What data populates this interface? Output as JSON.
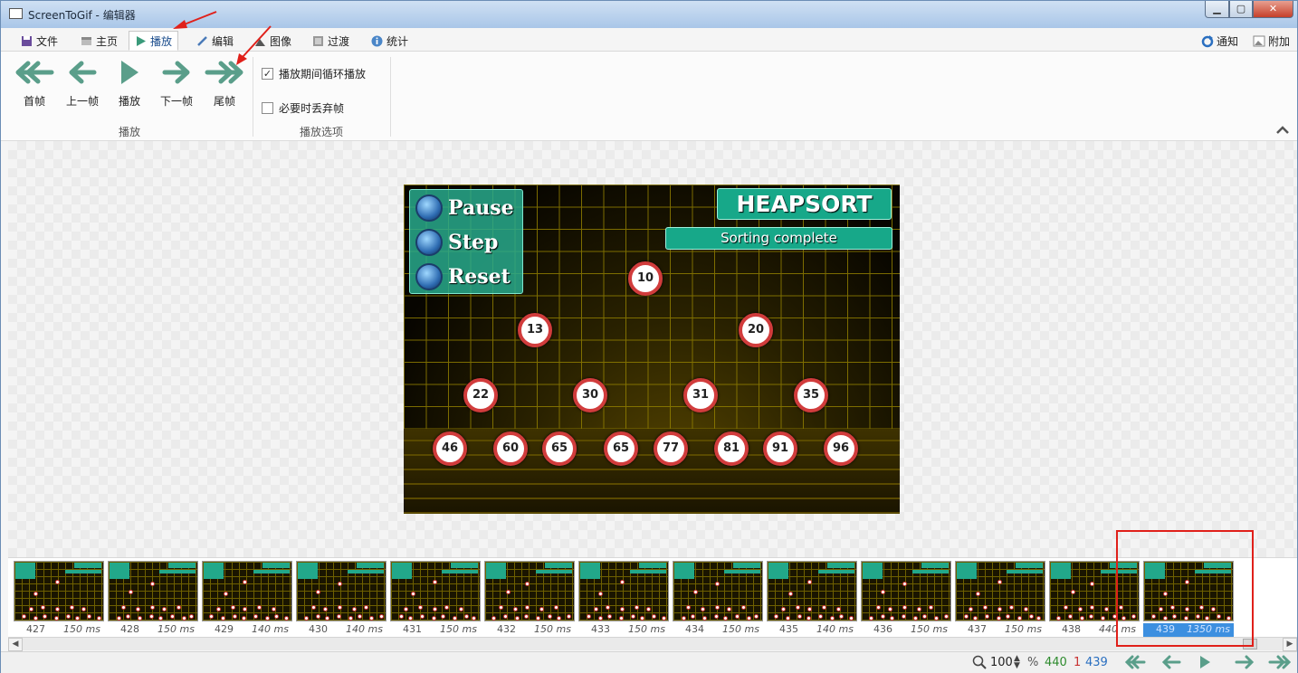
{
  "window": {
    "title": "ScreenToGif - 编辑器"
  },
  "tabs": [
    {
      "label": "文件",
      "icon": "save-icon"
    },
    {
      "label": "主页",
      "icon": "home-icon"
    },
    {
      "label": "播放",
      "icon": "play-icon",
      "active": true
    },
    {
      "label": "编辑",
      "icon": "pencil-icon"
    },
    {
      "label": "图像",
      "icon": "image-icon"
    },
    {
      "label": "过渡",
      "icon": "transition-icon"
    },
    {
      "label": "统计",
      "icon": "info-icon"
    }
  ],
  "top_right": {
    "notify": "通知",
    "attach": "附加"
  },
  "ribbon": {
    "playback_buttons": [
      {
        "label": "首帧",
        "icon": "first-frame-icon"
      },
      {
        "label": "上一帧",
        "icon": "previous-frame-icon"
      },
      {
        "label": "播放",
        "icon": "play-icon"
      },
      {
        "label": "下一帧",
        "icon": "next-frame-icon"
      },
      {
        "label": "尾帧",
        "icon": "last-frame-icon"
      }
    ],
    "playback_group": "播放",
    "options": [
      {
        "label": "播放期间循环播放",
        "checked": true
      },
      {
        "label": "必要时丢弃帧",
        "checked": false
      }
    ],
    "options_group": "播放选项"
  },
  "preview": {
    "controls": [
      "Pause",
      "Step",
      "Reset"
    ],
    "title": "HEAPSORT",
    "status": "Sorting complete",
    "nodes": [
      "10",
      "13",
      "20",
      "22",
      "30",
      "31",
      "35",
      "46",
      "60",
      "65",
      "65",
      "77",
      "81",
      "91",
      "96"
    ]
  },
  "frames": [
    {
      "num": "427",
      "ms": "150 ms"
    },
    {
      "num": "428",
      "ms": "150 ms"
    },
    {
      "num": "429",
      "ms": "140 ms"
    },
    {
      "num": "430",
      "ms": "140 ms"
    },
    {
      "num": "431",
      "ms": "150 ms"
    },
    {
      "num": "432",
      "ms": "150 ms"
    },
    {
      "num": "433",
      "ms": "150 ms"
    },
    {
      "num": "434",
      "ms": "150 ms"
    },
    {
      "num": "435",
      "ms": "140 ms"
    },
    {
      "num": "436",
      "ms": "150 ms"
    },
    {
      "num": "437",
      "ms": "150 ms"
    },
    {
      "num": "438",
      "ms": "440 ms"
    },
    {
      "num": "439",
      "ms": "1350 ms",
      "selected": true
    }
  ],
  "status": {
    "zoom": "100",
    "percent": "%",
    "total": "440",
    "selected": "1",
    "current": "439"
  },
  "colors": {
    "accent": "#1a4c8c",
    "total": "#2e8b2e",
    "selected": "#c83232",
    "current": "#2a6fc0",
    "highlight": "#e0201a"
  }
}
